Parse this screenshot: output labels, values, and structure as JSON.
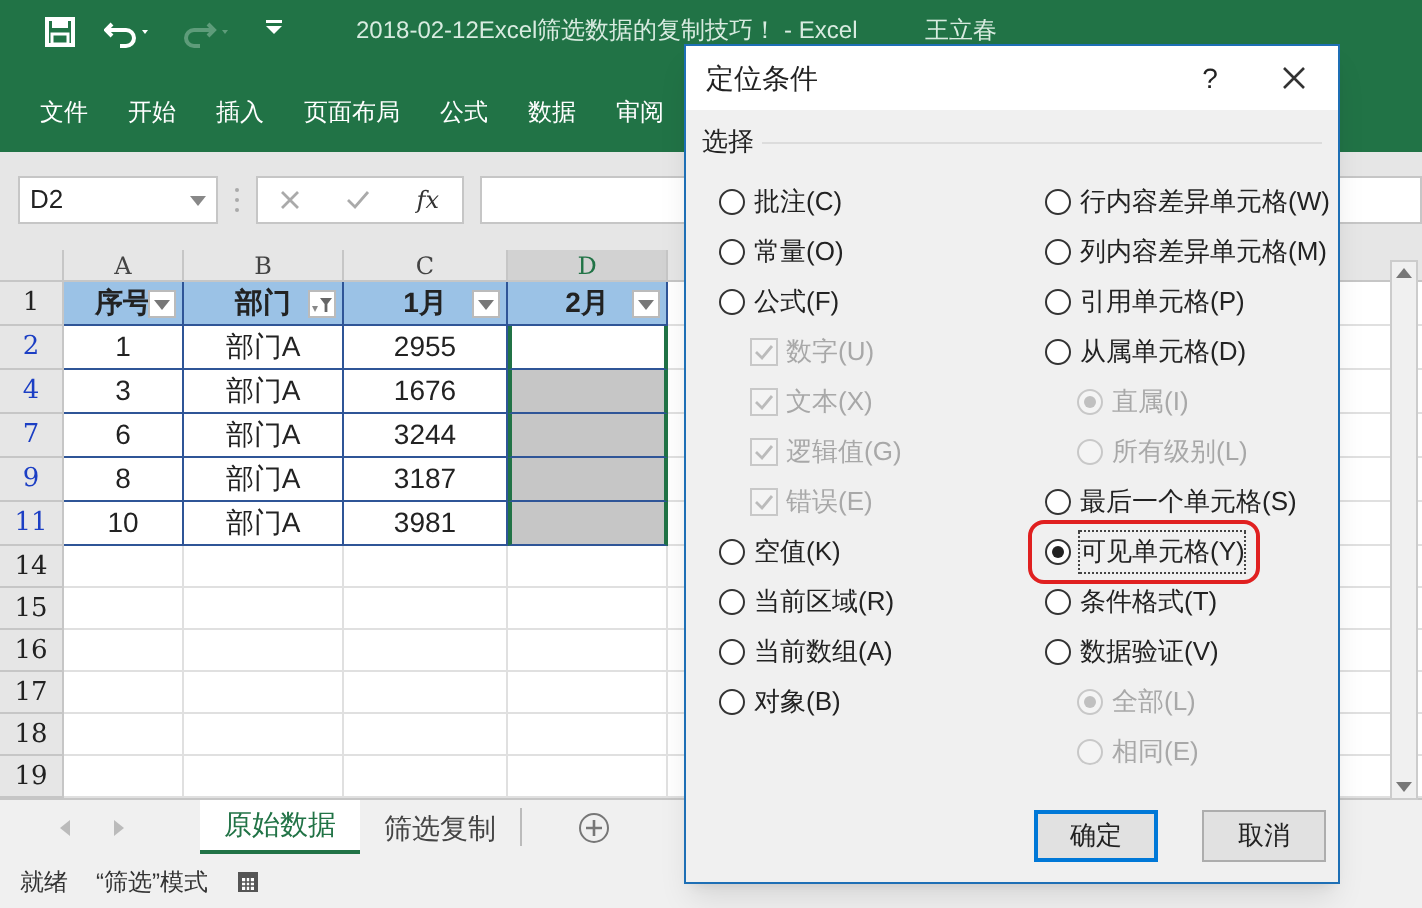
{
  "window": {
    "title": "2018-02-12Excel筛选数据的复制技巧！ - Excel",
    "user": "王立春"
  },
  "ribbon_tabs": [
    "文件",
    "开始",
    "插入",
    "页面布局",
    "公式",
    "数据",
    "审阅"
  ],
  "formula_bar": {
    "name_box": "D2",
    "fx": "fx"
  },
  "sheet": {
    "columns": [
      {
        "label": "A",
        "selected": false
      },
      {
        "label": "B",
        "selected": false
      },
      {
        "label": "C",
        "selected": false
      },
      {
        "label": "D",
        "selected": true
      }
    ],
    "header_row": {
      "row": "1",
      "cells": [
        {
          "text": "序号",
          "filtered": false
        },
        {
          "text": "部门",
          "filtered": true
        },
        {
          "text": "1月",
          "filtered": false
        },
        {
          "text": "2月",
          "filtered": false
        }
      ]
    },
    "rows": [
      {
        "row": "2",
        "active": true,
        "cells": [
          "1",
          "部门A",
          "2955",
          ""
        ]
      },
      {
        "row": "4",
        "active": false,
        "cells": [
          "3",
          "部门A",
          "1676",
          ""
        ]
      },
      {
        "row": "7",
        "active": false,
        "cells": [
          "6",
          "部门A",
          "3244",
          ""
        ]
      },
      {
        "row": "9",
        "active": false,
        "cells": [
          "8",
          "部门A",
          "3187",
          ""
        ]
      },
      {
        "row": "11",
        "active": false,
        "cells": [
          "10",
          "部门A",
          "3981",
          ""
        ]
      }
    ],
    "empty_rows": [
      "14",
      "15",
      "16",
      "17",
      "18",
      "19"
    ]
  },
  "sheet_tabs": [
    {
      "label": "原始数据",
      "selected": true
    },
    {
      "label": "筛选复制",
      "selected": false
    }
  ],
  "status_bar": [
    "就绪",
    "“筛选”模式"
  ],
  "dialog": {
    "title": "定位条件",
    "help": "?",
    "section": "选择",
    "left": [
      {
        "kind": "radio",
        "label": "批注(C)",
        "selected": false,
        "highlighted": false
      },
      {
        "kind": "radio",
        "label": "常量(O)",
        "selected": false,
        "highlighted": false
      },
      {
        "kind": "radio",
        "label": "公式(F)",
        "selected": false,
        "highlighted": false,
        "children": [
          {
            "kind": "checkbox",
            "label": "数字(U)",
            "checked": true,
            "disabled": true
          },
          {
            "kind": "checkbox",
            "label": "文本(X)",
            "checked": true,
            "disabled": true
          },
          {
            "kind": "checkbox",
            "label": "逻辑值(G)",
            "checked": true,
            "disabled": true
          },
          {
            "kind": "checkbox",
            "label": "错误(E)",
            "checked": true,
            "disabled": true
          }
        ]
      },
      {
        "kind": "radio",
        "label": "空值(K)",
        "selected": false,
        "highlighted": false
      },
      {
        "kind": "radio",
        "label": "当前区域(R)",
        "selected": false,
        "highlighted": false
      },
      {
        "kind": "radio",
        "label": "当前数组(A)",
        "selected": false,
        "highlighted": false
      },
      {
        "kind": "radio",
        "label": "对象(B)",
        "selected": false,
        "highlighted": false
      }
    ],
    "right": [
      {
        "kind": "radio",
        "label": "行内容差异单元格(W)",
        "selected": false,
        "highlighted": false
      },
      {
        "kind": "radio",
        "label": "列内容差异单元格(M)",
        "selected": false,
        "highlighted": false
      },
      {
        "kind": "radio",
        "label": "引用单元格(P)",
        "selected": false,
        "highlighted": false
      },
      {
        "kind": "radio",
        "label": "从属单元格(D)",
        "selected": false,
        "highlighted": false,
        "children": [
          {
            "kind": "radio",
            "label": "直属(I)",
            "selected": true,
            "disabled": true
          },
          {
            "kind": "radio",
            "label": "所有级别(L)",
            "selected": false,
            "disabled": true
          }
        ]
      },
      {
        "kind": "radio",
        "label": "最后一个单元格(S)",
        "selected": false,
        "highlighted": false
      },
      {
        "kind": "radio",
        "label": "可见单元格(Y)",
        "selected": true,
        "highlighted": true
      },
      {
        "kind": "radio",
        "label": "条件格式(T)",
        "selected": false,
        "highlighted": false
      },
      {
        "kind": "radio",
        "label": "数据验证(V)",
        "selected": false,
        "highlighted": false,
        "children": [
          {
            "kind": "radio",
            "label": "全部(L)",
            "selected": true,
            "disabled": true
          },
          {
            "kind": "radio",
            "label": "相同(E)",
            "selected": false,
            "disabled": true
          }
        ]
      }
    ],
    "buttons": [
      {
        "label": "确定",
        "default": true
      },
      {
        "label": "取消",
        "default": false
      }
    ]
  }
}
